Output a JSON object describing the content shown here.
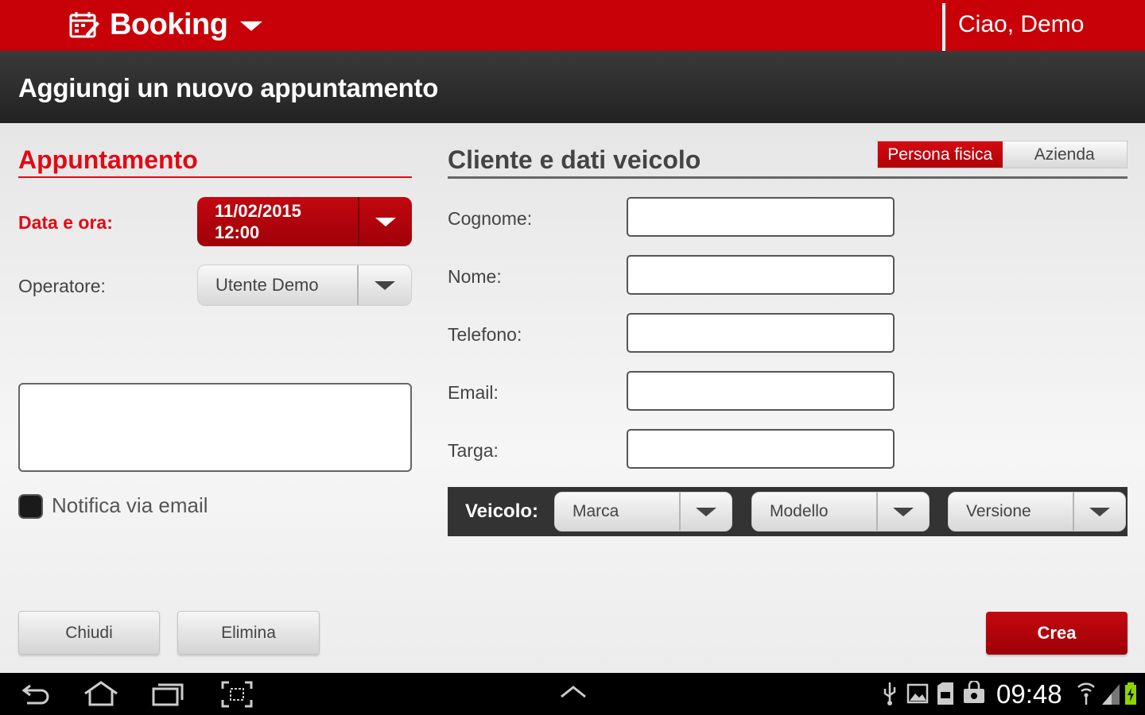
{
  "app": {
    "title": "Booking",
    "greeting": "Ciao, Demo"
  },
  "header": {
    "title": "Aggiungi un nuovo appuntamento"
  },
  "appointment": {
    "section_title": "Appuntamento",
    "date_label": "Data e ora:",
    "date_value": "11/02/2015",
    "time_value": "12:00",
    "operator_label": "Operatore:",
    "operator_value": "Utente Demo",
    "notes_value": "",
    "email_notify_label": "Notifica via email"
  },
  "client": {
    "section_title": "Cliente e dati veicolo",
    "type_options": [
      "Persona fisica",
      "Azienda"
    ],
    "fields": [
      {
        "label": "Cognome:",
        "value": ""
      },
      {
        "label": "Nome:",
        "value": ""
      },
      {
        "label": "Telefono:",
        "value": ""
      },
      {
        "label": "Email:",
        "value": ""
      },
      {
        "label": "Targa:",
        "value": ""
      }
    ],
    "vehicle": {
      "label": "Veicolo:",
      "brand": "Marca",
      "model": "Modello",
      "version": "Versione"
    }
  },
  "buttons": {
    "close": "Chiudi",
    "delete": "Elimina",
    "create": "Crea"
  },
  "system_bar": {
    "clock": "09:48"
  },
  "colors": {
    "brand_red": "#c80008",
    "accent_red": "#e10a14",
    "header_dark": "#2a2a2a"
  }
}
